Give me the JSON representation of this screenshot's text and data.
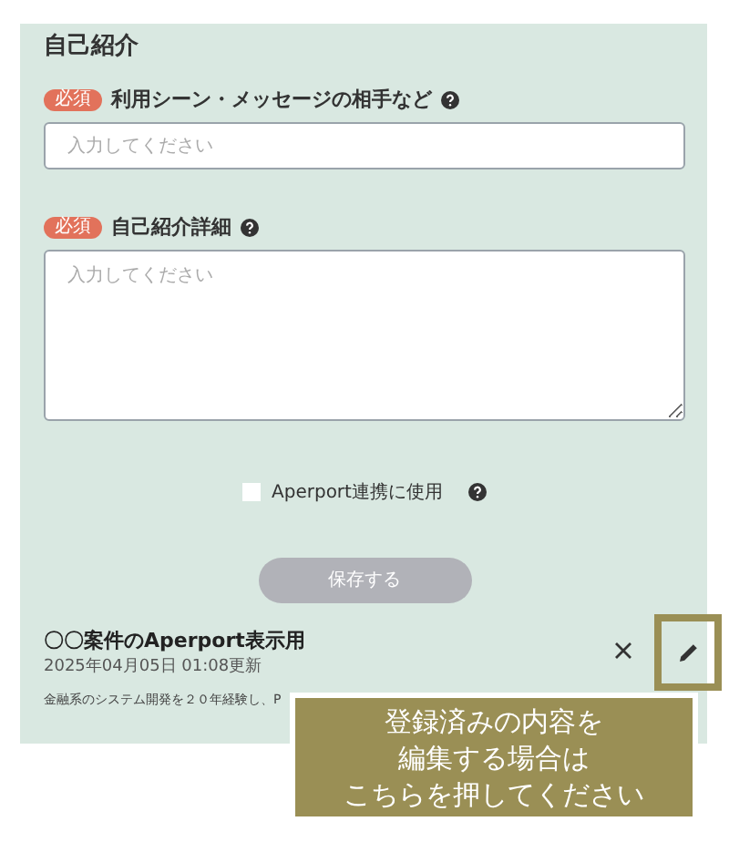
{
  "section_title": "自己紹介",
  "fields": [
    {
      "kind": "input",
      "badge": "必須",
      "label": "利用シーン・メッセージの相手など",
      "placeholder": "入力してください"
    },
    {
      "kind": "textarea",
      "badge": "必須",
      "label": "自己紹介詳細",
      "placeholder": "入力してください"
    }
  ],
  "aperport_checkbox": {
    "label": "Aperport連携に使用",
    "checked": false
  },
  "save_button": {
    "label": "保存する",
    "disabled": true
  },
  "saved_entry": {
    "title": "〇〇案件のAperport表示用",
    "updated": "2025年04月05日 01:08更新",
    "excerpt": "金融系のシステム開発を２０年経験し、P",
    "highlight_edit": true
  },
  "callout": {
    "lines": [
      "登録済みの内容を",
      "編集する場合は",
      "こちらを押してください"
    ]
  }
}
